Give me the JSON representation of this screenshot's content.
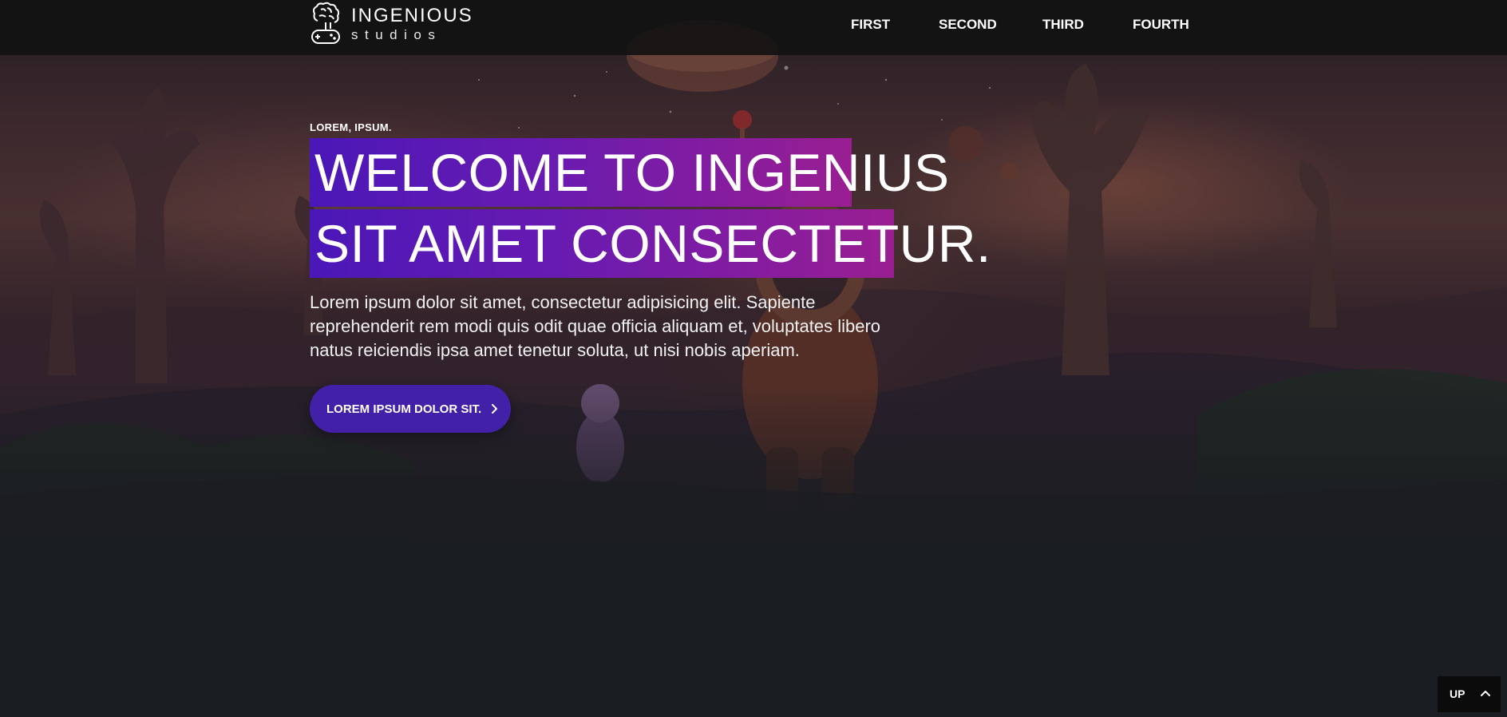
{
  "brand": {
    "name": "INGENIOUS",
    "tagline": "studios",
    "logo_icon": "brain-gamepad-icon"
  },
  "nav": {
    "items": [
      {
        "label": "FIRST"
      },
      {
        "label": "SECOND"
      },
      {
        "label": "THIRD"
      },
      {
        "label": "FOURTH"
      }
    ]
  },
  "hero": {
    "eyebrow": "LOREM, IPSUM.",
    "headline": [
      "WELCOME TO INGENIUS",
      "SIT AMET CONSECTETUR."
    ],
    "body": "Lorem ipsum dolor sit amet, consectetur adipisicing elit. Sapiente reprehenderit rem modi quis odit quae officia aliquam et, voluptates libero natus reiciendis ipsa amet tenetur soluta, ut nisi nobis aperiam.",
    "cta_label": "LOREM IPSUM DOLOR SIT.",
    "cta_icon": "chevron-right-icon"
  },
  "back_to_top": {
    "label": "UP",
    "icon": "chevron-up-icon"
  },
  "colors": {
    "nav_bg": "#121212",
    "page_bg": "#1a1d21",
    "headline_gradient_start": "#4a17b8",
    "headline_gradient_end": "#9a1e92",
    "cta_bg": "#4220a8",
    "text": "#ffffff"
  }
}
